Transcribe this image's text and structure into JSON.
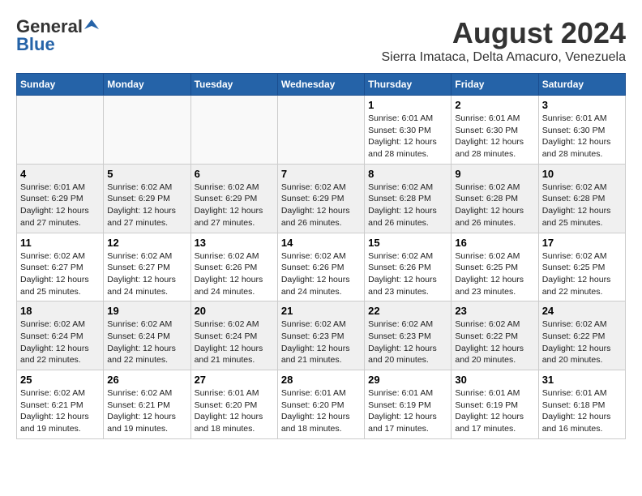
{
  "header": {
    "logo_general": "General",
    "logo_blue": "Blue",
    "main_title": "August 2024",
    "sub_title": "Sierra Imataca, Delta Amacuro, Venezuela"
  },
  "calendar": {
    "days_of_week": [
      "Sunday",
      "Monday",
      "Tuesday",
      "Wednesday",
      "Thursday",
      "Friday",
      "Saturday"
    ],
    "weeks": [
      {
        "days": [
          {
            "number": "",
            "info": ""
          },
          {
            "number": "",
            "info": ""
          },
          {
            "number": "",
            "info": ""
          },
          {
            "number": "",
            "info": ""
          },
          {
            "number": "1",
            "info": "Sunrise: 6:01 AM\nSunset: 6:30 PM\nDaylight: 12 hours\nand 28 minutes."
          },
          {
            "number": "2",
            "info": "Sunrise: 6:01 AM\nSunset: 6:30 PM\nDaylight: 12 hours\nand 28 minutes."
          },
          {
            "number": "3",
            "info": "Sunrise: 6:01 AM\nSunset: 6:30 PM\nDaylight: 12 hours\nand 28 minutes."
          }
        ]
      },
      {
        "days": [
          {
            "number": "4",
            "info": "Sunrise: 6:01 AM\nSunset: 6:29 PM\nDaylight: 12 hours\nand 27 minutes."
          },
          {
            "number": "5",
            "info": "Sunrise: 6:02 AM\nSunset: 6:29 PM\nDaylight: 12 hours\nand 27 minutes."
          },
          {
            "number": "6",
            "info": "Sunrise: 6:02 AM\nSunset: 6:29 PM\nDaylight: 12 hours\nand 27 minutes."
          },
          {
            "number": "7",
            "info": "Sunrise: 6:02 AM\nSunset: 6:29 PM\nDaylight: 12 hours\nand 26 minutes."
          },
          {
            "number": "8",
            "info": "Sunrise: 6:02 AM\nSunset: 6:28 PM\nDaylight: 12 hours\nand 26 minutes."
          },
          {
            "number": "9",
            "info": "Sunrise: 6:02 AM\nSunset: 6:28 PM\nDaylight: 12 hours\nand 26 minutes."
          },
          {
            "number": "10",
            "info": "Sunrise: 6:02 AM\nSunset: 6:28 PM\nDaylight: 12 hours\nand 25 minutes."
          }
        ]
      },
      {
        "days": [
          {
            "number": "11",
            "info": "Sunrise: 6:02 AM\nSunset: 6:27 PM\nDaylight: 12 hours\nand 25 minutes."
          },
          {
            "number": "12",
            "info": "Sunrise: 6:02 AM\nSunset: 6:27 PM\nDaylight: 12 hours\nand 24 minutes."
          },
          {
            "number": "13",
            "info": "Sunrise: 6:02 AM\nSunset: 6:26 PM\nDaylight: 12 hours\nand 24 minutes."
          },
          {
            "number": "14",
            "info": "Sunrise: 6:02 AM\nSunset: 6:26 PM\nDaylight: 12 hours\nand 24 minutes."
          },
          {
            "number": "15",
            "info": "Sunrise: 6:02 AM\nSunset: 6:26 PM\nDaylight: 12 hours\nand 23 minutes."
          },
          {
            "number": "16",
            "info": "Sunrise: 6:02 AM\nSunset: 6:25 PM\nDaylight: 12 hours\nand 23 minutes."
          },
          {
            "number": "17",
            "info": "Sunrise: 6:02 AM\nSunset: 6:25 PM\nDaylight: 12 hours\nand 22 minutes."
          }
        ]
      },
      {
        "days": [
          {
            "number": "18",
            "info": "Sunrise: 6:02 AM\nSunset: 6:24 PM\nDaylight: 12 hours\nand 22 minutes."
          },
          {
            "number": "19",
            "info": "Sunrise: 6:02 AM\nSunset: 6:24 PM\nDaylight: 12 hours\nand 22 minutes."
          },
          {
            "number": "20",
            "info": "Sunrise: 6:02 AM\nSunset: 6:24 PM\nDaylight: 12 hours\nand 21 minutes."
          },
          {
            "number": "21",
            "info": "Sunrise: 6:02 AM\nSunset: 6:23 PM\nDaylight: 12 hours\nand 21 minutes."
          },
          {
            "number": "22",
            "info": "Sunrise: 6:02 AM\nSunset: 6:23 PM\nDaylight: 12 hours\nand 20 minutes."
          },
          {
            "number": "23",
            "info": "Sunrise: 6:02 AM\nSunset: 6:22 PM\nDaylight: 12 hours\nand 20 minutes."
          },
          {
            "number": "24",
            "info": "Sunrise: 6:02 AM\nSunset: 6:22 PM\nDaylight: 12 hours\nand 20 minutes."
          }
        ]
      },
      {
        "days": [
          {
            "number": "25",
            "info": "Sunrise: 6:02 AM\nSunset: 6:21 PM\nDaylight: 12 hours\nand 19 minutes."
          },
          {
            "number": "26",
            "info": "Sunrise: 6:02 AM\nSunset: 6:21 PM\nDaylight: 12 hours\nand 19 minutes."
          },
          {
            "number": "27",
            "info": "Sunrise: 6:01 AM\nSunset: 6:20 PM\nDaylight: 12 hours\nand 18 minutes."
          },
          {
            "number": "28",
            "info": "Sunrise: 6:01 AM\nSunset: 6:20 PM\nDaylight: 12 hours\nand 18 minutes."
          },
          {
            "number": "29",
            "info": "Sunrise: 6:01 AM\nSunset: 6:19 PM\nDaylight: 12 hours\nand 17 minutes."
          },
          {
            "number": "30",
            "info": "Sunrise: 6:01 AM\nSunset: 6:19 PM\nDaylight: 12 hours\nand 17 minutes."
          },
          {
            "number": "31",
            "info": "Sunrise: 6:01 AM\nSunset: 6:18 PM\nDaylight: 12 hours\nand 16 minutes."
          }
        ]
      }
    ]
  }
}
